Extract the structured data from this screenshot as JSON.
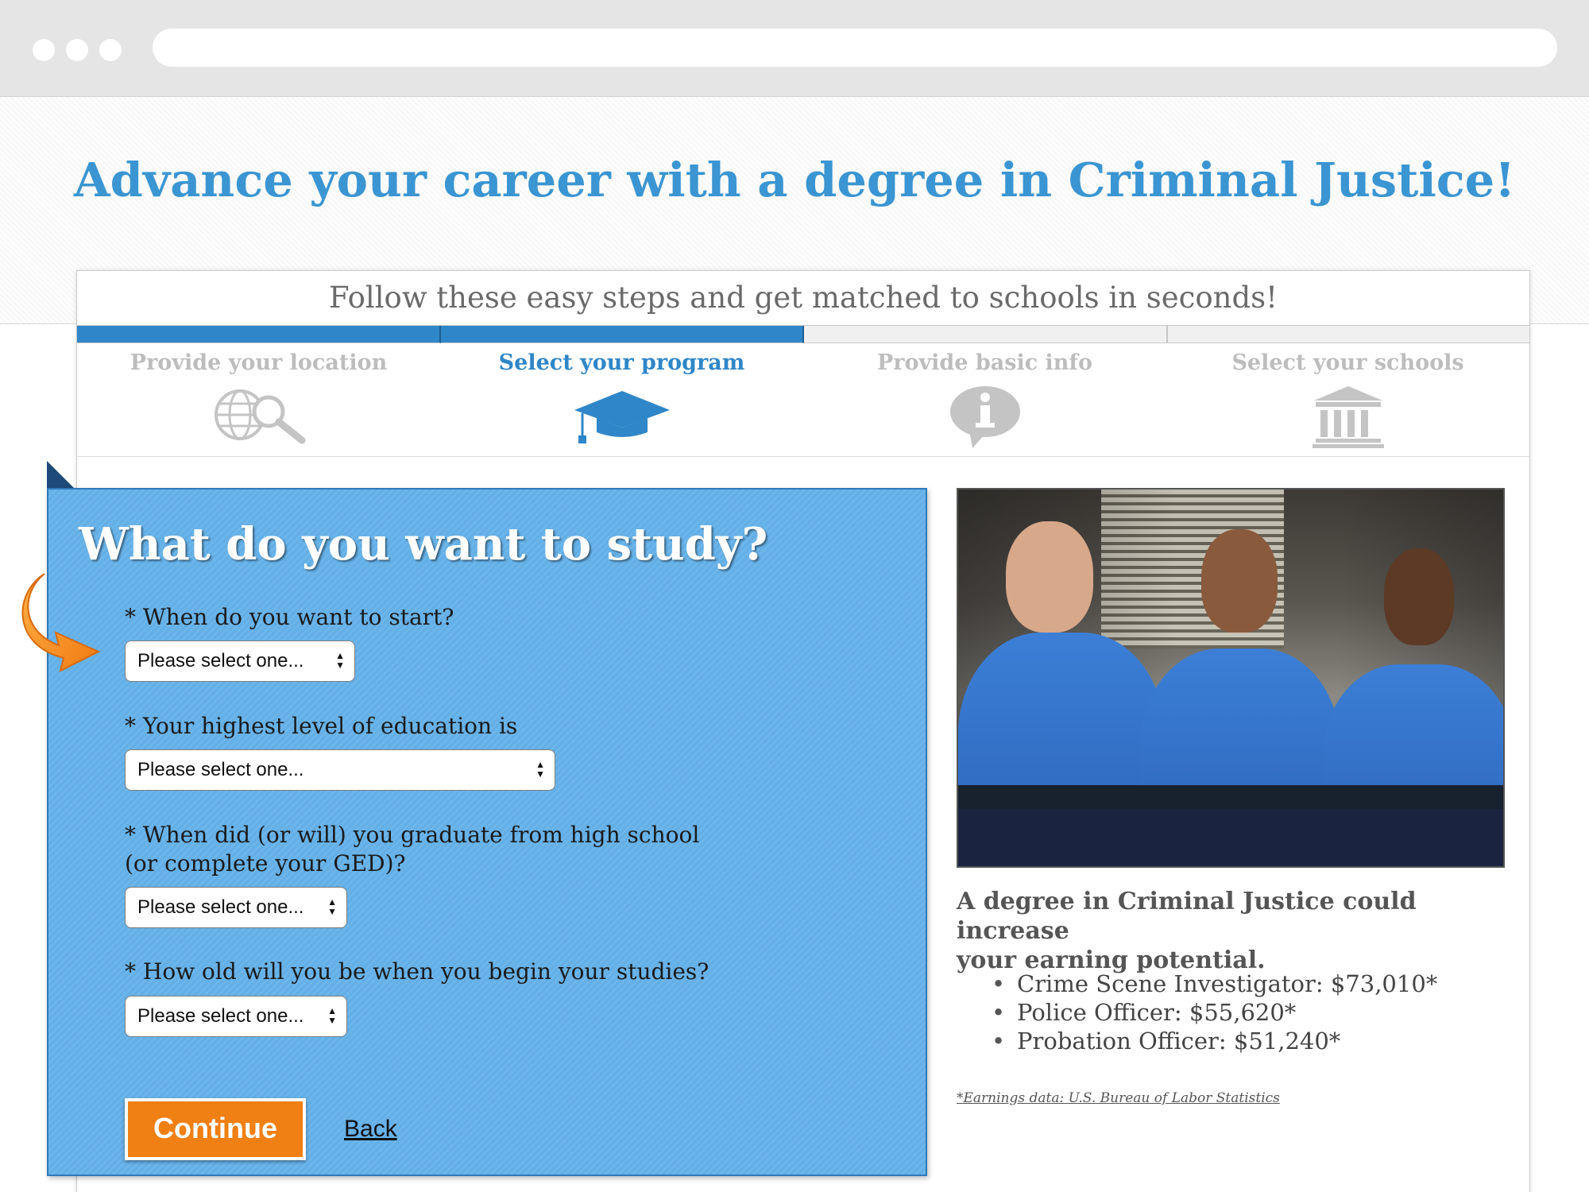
{
  "headline": "Advance your career with a degree in Criminal Justice!",
  "subheadline": "Follow these easy steps and get matched to schools in seconds!",
  "progress": {
    "completed_steps": 2,
    "total_steps": 4
  },
  "steps": [
    {
      "label": "Provide your location",
      "icon": "globe-search-icon",
      "active": false
    },
    {
      "label": "Select your program",
      "icon": "graduation-cap-icon",
      "active": true
    },
    {
      "label": "Provide basic info",
      "icon": "info-bubble-icon",
      "active": false
    },
    {
      "label": "Select your schools",
      "icon": "school-building-icon",
      "active": false
    }
  ],
  "form": {
    "title": "What do you want to study?",
    "questions": [
      {
        "label": "* When do you want to start?",
        "selected": "Please select one..."
      },
      {
        "label": "* Your highest level of education is",
        "selected": "Please select one..."
      },
      {
        "label": "* When did (or will) you graduate from high school",
        "label_line2": "(or complete your GED)?",
        "selected": "Please select one..."
      },
      {
        "label": "* How old will you be when you begin your studies?",
        "selected": "Please select one..."
      }
    ],
    "continue_label": "Continue",
    "back_label": "Back"
  },
  "sidebar": {
    "caption_line1": "A degree in Criminal Justice could increase",
    "caption_line2": "your earning potential.",
    "salaries": [
      "Crime Scene Investigator: $73,010*",
      "Police Officer: $55,620*",
      "Probation Officer: $51,240*"
    ],
    "footnote": "*Earnings data: U.S. Bureau of Labor Statistics"
  },
  "colors": {
    "accent": "#2f86c8",
    "headline": "#3a95d2",
    "form_bg": "#6db7ec",
    "button": "#f07f14"
  }
}
